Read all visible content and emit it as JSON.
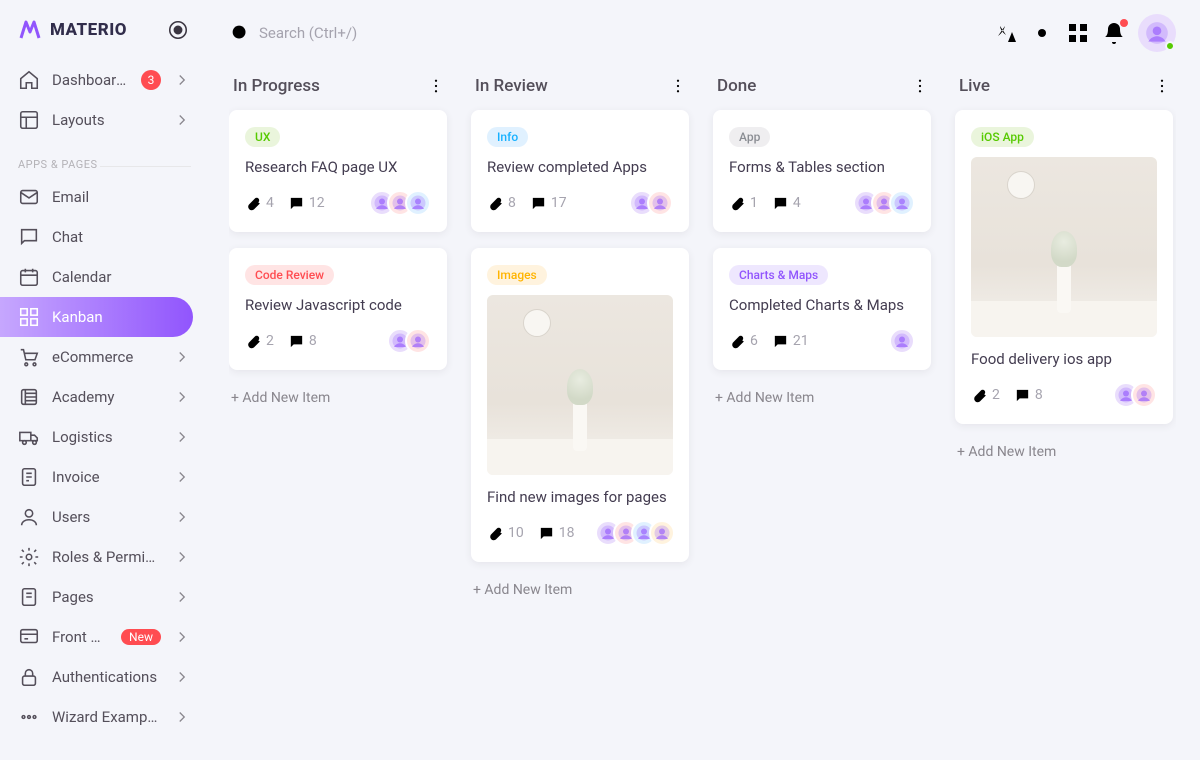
{
  "brand": {
    "name": "MATERIO"
  },
  "search": {
    "placeholder": "Search (Ctrl+/)"
  },
  "sidebar": {
    "section_label": "APPS & PAGES",
    "items": [
      {
        "label": "Dashboards",
        "icon": "home",
        "count": "3",
        "chev": true
      },
      {
        "label": "Layouts",
        "icon": "layout",
        "chev": true
      },
      {
        "label": "Email",
        "icon": "mail"
      },
      {
        "label": "Chat",
        "icon": "chat"
      },
      {
        "label": "Calendar",
        "icon": "calendar"
      },
      {
        "label": "Kanban",
        "icon": "kanban",
        "active": true
      },
      {
        "label": "eCommerce",
        "icon": "cart",
        "chev": true
      },
      {
        "label": "Academy",
        "icon": "academy",
        "chev": true
      },
      {
        "label": "Logistics",
        "icon": "truck",
        "chev": true
      },
      {
        "label": "Invoice",
        "icon": "invoice",
        "chev": true
      },
      {
        "label": "Users",
        "icon": "user",
        "chev": true
      },
      {
        "label": "Roles & Permissi...",
        "icon": "settings",
        "chev": true
      },
      {
        "label": "Pages",
        "icon": "pages",
        "chev": true
      },
      {
        "label": "Front Pages",
        "icon": "front",
        "badge": "New",
        "chev": true
      },
      {
        "label": "Authentications",
        "icon": "lock",
        "chev": true
      },
      {
        "label": "Wizard Examples",
        "icon": "dots",
        "chev": true
      }
    ]
  },
  "board": {
    "add_label": "+ Add New Item",
    "columns": [
      {
        "title": "In Progress",
        "cards": [
          {
            "chip": "UX",
            "chip_class": "ux",
            "title": "Research FAQ page UX",
            "attachments": "4",
            "comments": "12",
            "avatars": 3
          },
          {
            "chip": "Code Review",
            "chip_class": "code",
            "title": "Review Javascript code",
            "attachments": "2",
            "comments": "8",
            "avatars": 2
          }
        ]
      },
      {
        "title": "In Review",
        "cards": [
          {
            "chip": "Info",
            "chip_class": "info",
            "title": "Review completed Apps",
            "attachments": "8",
            "comments": "17",
            "avatars": 2
          },
          {
            "chip": "Images",
            "chip_class": "images",
            "title": "Find new images for pages",
            "attachments": "10",
            "comments": "18",
            "avatars": 4,
            "image": true
          }
        ]
      },
      {
        "title": "Done",
        "cards": [
          {
            "chip": "App",
            "chip_class": "app",
            "title": "Forms & Tables section",
            "attachments": "1",
            "comments": "4",
            "avatars": 3
          },
          {
            "chip": "Charts & Maps",
            "chip_class": "charts",
            "title": "Completed Charts & Maps",
            "attachments": "6",
            "comments": "21",
            "avatars": 1
          }
        ]
      },
      {
        "title": "Live",
        "cards": [
          {
            "chip": "iOS App",
            "chip_class": "ios",
            "title": "Food delivery ios app",
            "attachments": "2",
            "comments": "8",
            "avatars": 2,
            "image": true,
            "image_first": true
          }
        ]
      }
    ]
  },
  "avatar_colors": [
    "#e9ddfc",
    "#ffe4e4",
    "#e0f1ff",
    "#fff3de",
    "#eee7fe"
  ]
}
